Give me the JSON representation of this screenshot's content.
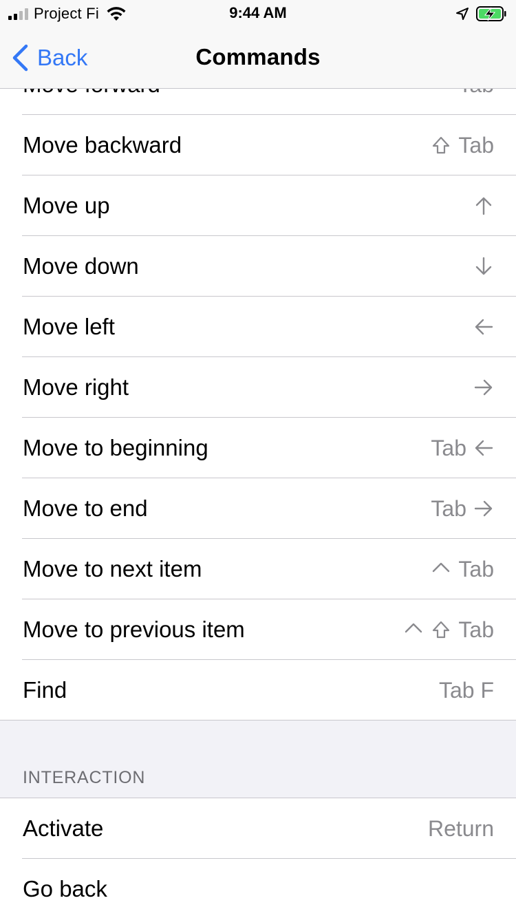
{
  "status_bar": {
    "carrier": "Project Fi",
    "time": "9:44 AM",
    "colors": {
      "charging": "#4cd964"
    }
  },
  "nav": {
    "back_label": "Back",
    "title": "Commands",
    "accent": "#3478f6"
  },
  "navigation_rows": [
    {
      "label": "Move forward",
      "keys": [
        {
          "text": "Tab"
        }
      ]
    },
    {
      "label": "Move backward",
      "keys": [
        {
          "icon": "shift-icon"
        },
        {
          "text": "Tab"
        }
      ]
    },
    {
      "label": "Move up",
      "keys": [
        {
          "icon": "arrow-up-icon"
        }
      ]
    },
    {
      "label": "Move down",
      "keys": [
        {
          "icon": "arrow-down-icon"
        }
      ]
    },
    {
      "label": "Move left",
      "keys": [
        {
          "icon": "arrow-left-icon"
        }
      ]
    },
    {
      "label": "Move right",
      "keys": [
        {
          "icon": "arrow-right-icon"
        }
      ]
    },
    {
      "label": "Move to beginning",
      "keys": [
        {
          "text": "Tab"
        },
        {
          "icon": "arrow-left-icon"
        }
      ]
    },
    {
      "label": "Move to end",
      "keys": [
        {
          "text": "Tab"
        },
        {
          "icon": "arrow-right-icon"
        }
      ]
    },
    {
      "label": "Move to next item",
      "keys": [
        {
          "icon": "control-icon"
        },
        {
          "text": "Tab"
        }
      ]
    },
    {
      "label": "Move to previous item",
      "keys": [
        {
          "icon": "control-icon"
        },
        {
          "icon": "shift-icon"
        },
        {
          "text": "Tab"
        }
      ]
    },
    {
      "label": "Find",
      "keys": [
        {
          "text": "Tab F"
        }
      ]
    }
  ],
  "interaction_section": {
    "header": "INTERACTION",
    "rows": [
      {
        "label": "Activate",
        "keys": [
          {
            "text": "Return"
          }
        ]
      },
      {
        "label": "Go back",
        "keys": []
      }
    ]
  }
}
